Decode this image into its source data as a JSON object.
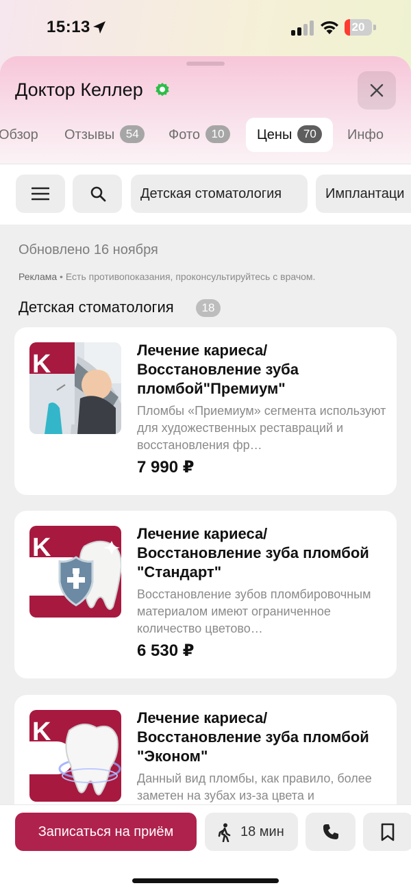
{
  "status_bar": {
    "time": "15:13",
    "battery": "20",
    "battery_level_percent": 20
  },
  "header": {
    "title": "Доктор Келлер",
    "tabs": [
      {
        "label": "Обзор",
        "count": ""
      },
      {
        "label": "Отзывы",
        "count": "54"
      },
      {
        "label": "Фото",
        "count": "10"
      },
      {
        "label": "Цены",
        "count": "70",
        "active": true
      },
      {
        "label": "Инфо",
        "count": ""
      }
    ]
  },
  "filters": {
    "chips": [
      "Детская стоматология",
      "Имплантаци"
    ]
  },
  "updated": "Обновлено 16 ноября",
  "ad": {
    "label": "Реклама",
    "text": " • Есть противопоказания, проконсультируйтесь с врачом."
  },
  "section": {
    "title": "Детская стоматология",
    "count": "18"
  },
  "items": [
    {
      "title": "Лечение кариеса/ Восстановление зуба пломбой\"Премиум\"",
      "description": "Пломбы «Приемиум» сегмента используют для художественных реставраций и восстановления фр…",
      "price": "7 990 ₽"
    },
    {
      "title": "Лечение кариеса/ Восстановление зуба пломбой \"Стандарт\"",
      "description": "Восстановление зубов пломбировочным материалом имеют ограниченное количество цветово…",
      "price": "6 530 ₽"
    },
    {
      "title": "Лечение кариеса/ Восстановление зуба пломбой \"Эконом\"",
      "description": "Данный вид пломбы, как правило, более заметен на зубах из-за цвета и",
      "price": ""
    }
  ],
  "logo_letter": "K",
  "bottom_bar": {
    "book_label": "Записаться на приём",
    "route_label": "18 мин"
  },
  "colors": {
    "brand": "#b0224e",
    "verified": "#2dbd4a",
    "battery": "#ff3b30"
  }
}
